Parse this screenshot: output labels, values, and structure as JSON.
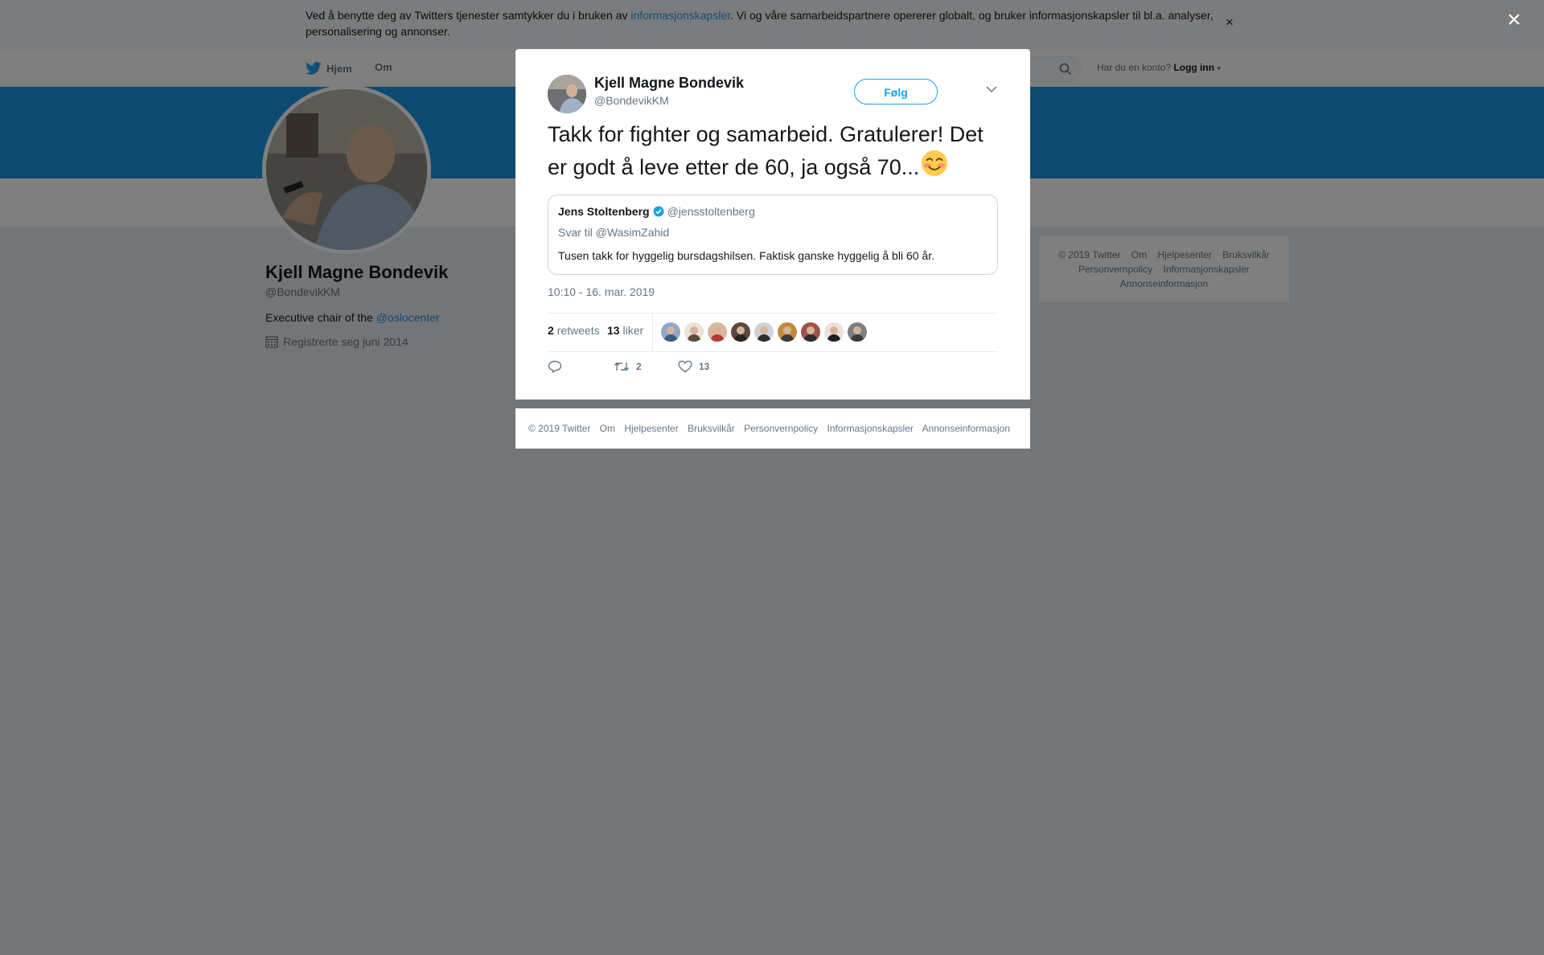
{
  "cookie": {
    "text_before": "Ved å benytte deg av Twitters tjenester samtykker du i bruken av ",
    "link": "informasjonskapsler",
    "text_after": ". Vi og våre samarbeidspartnere opererer globalt, og bruker informasjonskapsler til bl.a. analyser, personalisering og annonser.",
    "close": "×"
  },
  "nav": {
    "home": "Hjem",
    "about": "Om",
    "login_prompt": "Har du en konto?",
    "login": "Logg inn"
  },
  "profile": {
    "name": "Kjell Magne Bondevik",
    "handle": "@BondevikKM",
    "bio_prefix": "Executive chair of the ",
    "bio_link": "@oslocenter",
    "joined": "Registrerte seg juni 2014"
  },
  "side_footer": {
    "links": [
      "© 2019 Twitter",
      "Om",
      "Hjelpesenter",
      "Bruksvilkår",
      "Personvernpolicy",
      "Informasjonskapsler",
      "Annonseinformasjon"
    ]
  },
  "overlay": {
    "close": "×"
  },
  "tweet": {
    "author_name": "Kjell Magne Bondevik",
    "author_handle": "@BondevikKM",
    "follow": "Følg",
    "text": "Takk for fighter og samarbeid. Gratulerer! Det er godt å leve etter de 60, ja også 70...",
    "emoji": "smiling-face-emoji",
    "timestamp": "10:10 - 16. mar. 2019",
    "retweets_count": "2",
    "retweets_label": "retweets",
    "likes_count": "13",
    "likes_label": "liker",
    "reply_count": "",
    "retweet_action_count": "2",
    "like_action_count": "13",
    "liker_avatars": 9
  },
  "quote": {
    "name": "Jens Stoltenberg",
    "verified": true,
    "handle": "@jensstoltenberg",
    "reply_to": "Svar til @WasimZahid",
    "text": "Tusen takk for hyggelig bursdagshilsen. Faktisk ganske hyggelig å bli 60 år."
  },
  "modal_footer": {
    "copyright": "© 2019 Twitter",
    "about": "Om",
    "help": "Hjelpesenter",
    "terms": "Bruksvilkår",
    "privacy": "Personvernpolicy",
    "cookies": "Informasjonskapsler",
    "ads": "Annonseinformasjon"
  },
  "colors": {
    "accent": "#1da1f2",
    "banner": "#1b95e0",
    "overlay": "rgba(0,0,0,0.5)"
  }
}
